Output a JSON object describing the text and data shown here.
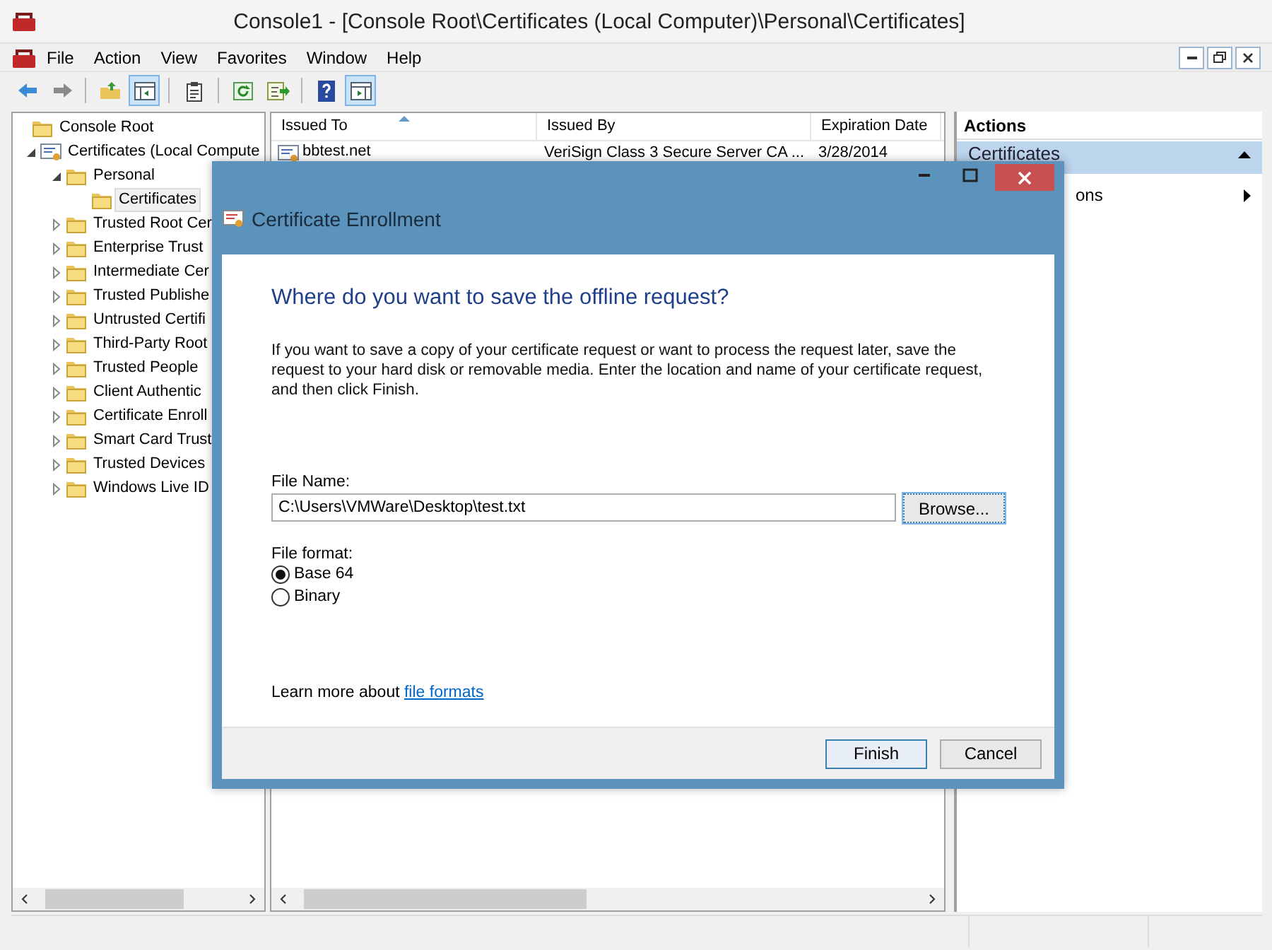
{
  "window": {
    "title": "Console1 - [Console Root\\Certificates (Local Computer)\\Personal\\Certificates]"
  },
  "menu": [
    "File",
    "Action",
    "View",
    "Favorites",
    "Window",
    "Help"
  ],
  "toolbar": [
    {
      "kind": "back",
      "pressed": false
    },
    {
      "kind": "forward",
      "pressed": false
    },
    {
      "kind": "separator"
    },
    {
      "kind": "up",
      "pressed": false
    },
    {
      "kind": "tree",
      "pressed": true
    },
    {
      "kind": "separator"
    },
    {
      "kind": "clipboard",
      "pressed": false
    },
    {
      "kind": "separator"
    },
    {
      "kind": "refresh",
      "pressed": false
    },
    {
      "kind": "export",
      "pressed": false
    },
    {
      "kind": "separator"
    },
    {
      "kind": "help",
      "pressed": false
    },
    {
      "kind": "actions",
      "pressed": true
    }
  ],
  "tree": [
    {
      "label": "Console Root",
      "kind": "root",
      "selected": false,
      "children": [
        {
          "label": "Certificates (Local Compute",
          "kind": "store",
          "expanded": true,
          "selected": false,
          "children": [
            {
              "label": "Personal",
              "kind": "folder",
              "expanded": true,
              "selected": false,
              "children": [
                {
                  "label": "Certificates",
                  "kind": "folder",
                  "selected": true
                }
              ]
            },
            {
              "label": "Trusted Root Cer",
              "kind": "folder",
              "expanded": false,
              "selected": false
            },
            {
              "label": "Enterprise Trust",
              "kind": "folder",
              "expanded": false,
              "selected": false
            },
            {
              "label": "Intermediate Cer",
              "kind": "folder",
              "expanded": false,
              "selected": false
            },
            {
              "label": "Trusted Publishe",
              "kind": "folder",
              "expanded": false,
              "selected": false
            },
            {
              "label": "Untrusted Certifi",
              "kind": "folder",
              "expanded": false,
              "selected": false
            },
            {
              "label": "Third-Party Root",
              "kind": "folder",
              "expanded": false,
              "selected": false
            },
            {
              "label": "Trusted People",
              "kind": "folder",
              "expanded": false,
              "selected": false
            },
            {
              "label": "Client Authentic",
              "kind": "folder",
              "expanded": false,
              "selected": false
            },
            {
              "label": "Certificate Enroll",
              "kind": "folder",
              "expanded": false,
              "selected": false
            },
            {
              "label": "Smart Card Trust",
              "kind": "folder",
              "expanded": false,
              "selected": false
            },
            {
              "label": "Trusted Devices",
              "kind": "folder",
              "expanded": false,
              "selected": false
            },
            {
              "label": "Windows Live ID",
              "kind": "folder",
              "expanded": false,
              "selected": false
            }
          ]
        }
      ]
    }
  ],
  "list": {
    "columns": [
      {
        "label": "Issued To",
        "sorted": true
      },
      {
        "label": "Issued By",
        "sorted": false
      },
      {
        "label": "Expiration Date",
        "sorted": false
      }
    ],
    "rows": [
      {
        "cells": [
          "bbtest.net",
          "VeriSign Class 3 Secure Server CA ...",
          "3/28/2014"
        ]
      }
    ]
  },
  "actions": {
    "title": "Actions",
    "section": {
      "label": "Certificates",
      "expanded": true
    },
    "items": [
      {
        "label": "ons"
      }
    ]
  },
  "dialog": {
    "title": "Certificate Enrollment",
    "heading": "Where do you want to save the offline request?",
    "body": "If you want to save a copy of your certificate request or want to process the request later, save the request to your hard disk or removable media. Enter the location and name of your certificate request, and then click Finish.",
    "file_name": {
      "label": "File Name:",
      "value": "C:\\Users\\VMWare\\Desktop\\test.txt"
    },
    "browse": "Browse...",
    "format": {
      "label": "File format:",
      "options": [
        {
          "label": "Base 64",
          "selected": true
        },
        {
          "label": "Binary",
          "selected": false
        }
      ]
    },
    "learn_more": {
      "text": "Learn more about",
      "link": "file formats"
    },
    "buttons": [
      {
        "label": "Finish",
        "default": true
      },
      {
        "label": "Cancel",
        "default": false
      }
    ]
  }
}
